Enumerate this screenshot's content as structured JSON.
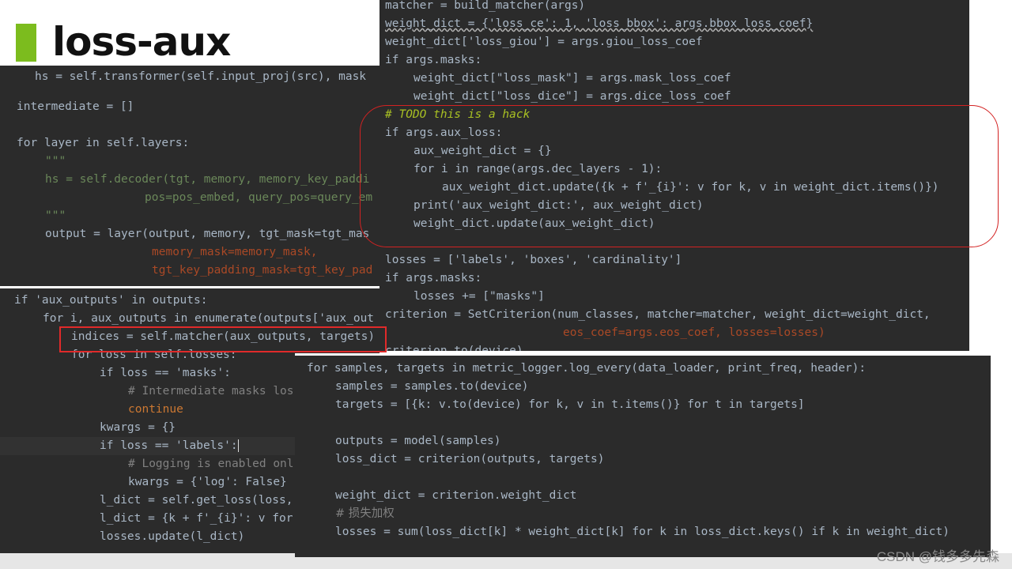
{
  "slide": {
    "title": "loss-aux"
  },
  "watermark": "CSDN @钱多多先森",
  "colors": {
    "accent_bar": "#7cbc1e",
    "editor_bg": "#2b2b2b",
    "annotation_red": "#e02a2a"
  },
  "panel_left_top": [
    "hs = self.transformer(self.input_proj(src), mask",
    "intermediate = []",
    "for layer in self.layers:",
    "\"\"\"",
    "hs = self.decoder(tgt, memory, memory_key_paddi",
    "pos=pos_embed, query_pos=query_em",
    "\"\"\"",
    "output = layer(output, memory, tgt_mask=tgt_mas",
    "memory_mask=memory_mask,",
    "tgt_key_padding_mask=tgt_key_pad"
  ],
  "panel_left_bottom": [
    "if 'aux_outputs' in outputs:",
    "for i, aux_outputs in enumerate(outputs['aux_out",
    "indices = self.matcher(aux_outputs, targets)",
    "for loss in self.losses:",
    "if loss == 'masks':",
    "# Intermediate masks los",
    "continue",
    "kwargs = {}",
    "if loss == 'labels':",
    "# Logging is enabled onl",
    "kwargs = {'log': False}",
    "l_dict = self.get_loss(loss,",
    "l_dict = {k + f'_{i}': v for",
    "losses.update(l_dict)"
  ],
  "panel_right_top": [
    "matcher = build_matcher(args)",
    "weight_dict = {'loss_ce': 1, 'loss_bbox': args.bbox_loss_coef}",
    "weight_dict['loss_giou'] = args.giou_loss_coef",
    "if args.masks:",
    "weight_dict[\"loss_mask\"] = args.mask_loss_coef",
    "weight_dict[\"loss_dice\"] = args.dice_loss_coef",
    "# TODO this is a hack",
    "if args.aux_loss:",
    "aux_weight_dict = {}",
    "for i in range(args.dec_layers - 1):",
    "aux_weight_dict.update({k + f'_{i}': v for k, v in weight_dict.items()})",
    "print('aux_weight_dict:', aux_weight_dict)",
    "weight_dict.update(aux_weight_dict)",
    "losses = ['labels', 'boxes', 'cardinality']",
    "if args.masks:",
    "losses += [\"masks\"]",
    "criterion = SetCriterion(num_classes, matcher=matcher, weight_dict=weight_dict,",
    "eos_coef=args.eos_coef, losses=losses)",
    "criterion.to(device)"
  ],
  "panel_bottom": [
    "for samples, targets in metric_logger.log_every(data_loader, print_freq, header):",
    "samples = samples.to(device)",
    "targets = [{k: v.to(device) for k, v in t.items()} for t in targets]",
    "outputs = model(samples)",
    "loss_dict = criterion(outputs, targets)",
    "weight_dict = criterion.weight_dict",
    "# 损失加权",
    "losses = sum(loss_dict[k] * weight_dict[k] for k in loss_dict.keys() if k in weight_dict)"
  ]
}
